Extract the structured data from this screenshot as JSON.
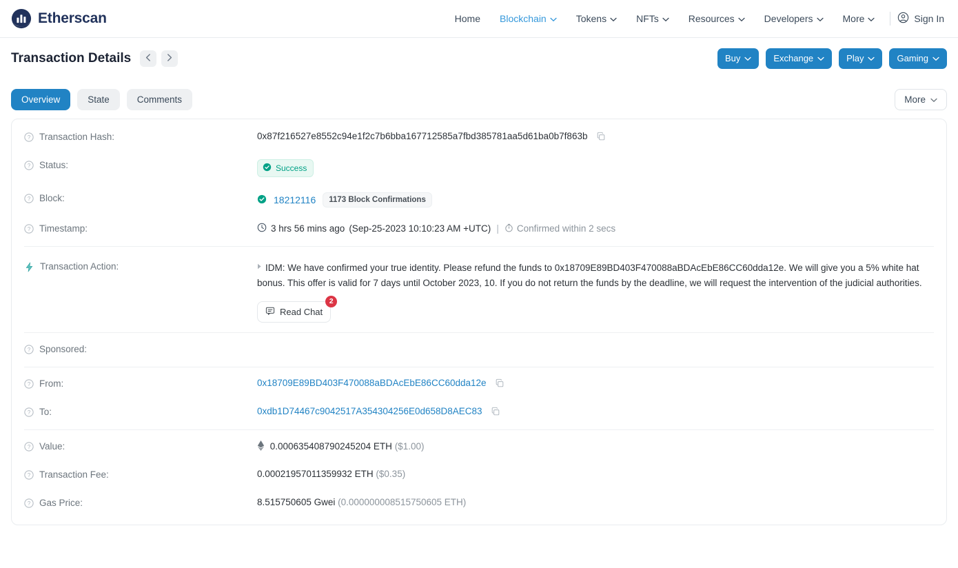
{
  "brand": {
    "name": "Etherscan",
    "logo_icon": "etherscan-logo"
  },
  "nav": {
    "items": [
      {
        "label": "Home",
        "has_chevron": false,
        "active": false
      },
      {
        "label": "Blockchain",
        "has_chevron": true,
        "active": true
      },
      {
        "label": "Tokens",
        "has_chevron": true,
        "active": false
      },
      {
        "label": "NFTs",
        "has_chevron": true,
        "active": false
      },
      {
        "label": "Resources",
        "has_chevron": true,
        "active": false
      },
      {
        "label": "Developers",
        "has_chevron": true,
        "active": false
      },
      {
        "label": "More",
        "has_chevron": true,
        "active": false
      }
    ],
    "sign_in": "Sign In",
    "sign_in_icon": "user-circle-icon",
    "active_color": "#3498db"
  },
  "subheader": {
    "title": "Transaction Details",
    "prev_icon": "chevron-left-icon",
    "next_icon": "chevron-right-icon",
    "promo_buttons": [
      {
        "label": "Buy"
      },
      {
        "label": "Exchange"
      },
      {
        "label": "Play"
      },
      {
        "label": "Gaming"
      }
    ],
    "promo_color": "#2183c4"
  },
  "tabs": {
    "items": [
      {
        "label": "Overview",
        "active": true
      },
      {
        "label": "State",
        "active": false
      },
      {
        "label": "Comments",
        "active": false
      }
    ],
    "more_label": "More"
  },
  "details": {
    "transaction_hash": {
      "label": "Transaction Hash:",
      "value": "0x87f216527e8552c94e1f2c7b6bba167712585a7fbd385781aa5d61ba0b7f863b",
      "copy_icon": "copy-icon"
    },
    "status": {
      "label": "Status:",
      "value": "Success",
      "icon": "check-circle-icon",
      "color": "#00a186"
    },
    "block": {
      "label": "Block:",
      "icon": "check-circle-icon",
      "number": "18212116",
      "confirmations": "1173 Block Confirmations"
    },
    "timestamp": {
      "label": "Timestamp:",
      "clock_icon": "clock-icon",
      "relative": "3 hrs 56 mins ago",
      "absolute": "(Sep-25-2023 10:10:23 AM +UTC)",
      "separator": "|",
      "stopwatch_icon": "stopwatch-icon",
      "confirmed_within": "Confirmed within 2 secs"
    },
    "transaction_action": {
      "label": "Transaction Action:",
      "icon": "lightning-bolt-icon",
      "caret_icon": "caret-right-icon",
      "message": "IDM: We have confirmed your true identity. Please refund the funds to 0x18709E89BD403F470088aBDAcEbE86CC60dda12e. We will give you a 5% white hat bonus. This offer is valid for 7 days until October 2023, 10. If you do not return the funds by the deadline, we will request the intervention of the judicial authorities.",
      "read_chat_label": "Read Chat",
      "read_chat_icon": "chat-icon",
      "badge_count": "2"
    },
    "sponsored": {
      "label": "Sponsored:",
      "value": ""
    },
    "from": {
      "label": "From:",
      "value": "0x18709E89BD403F470088aBDAcEbE86CC60dda12e",
      "copy_icon": "copy-icon"
    },
    "to": {
      "label": "To:",
      "value": "0xdb1D74467c9042517A354304256E0d658D8AEC83",
      "copy_icon": "copy-icon"
    },
    "value": {
      "label": "Value:",
      "icon": "ethereum-icon",
      "amount": "0.000635408790245204 ETH",
      "fiat": "($1.00)"
    },
    "transaction_fee": {
      "label": "Transaction Fee:",
      "amount": "0.00021957011359932 ETH",
      "fiat": "($0.35)"
    },
    "gas_price": {
      "label": "Gas Price:",
      "amount": "8.515750605 Gwei",
      "eth": "(0.000000008515750605 ETH)"
    }
  }
}
